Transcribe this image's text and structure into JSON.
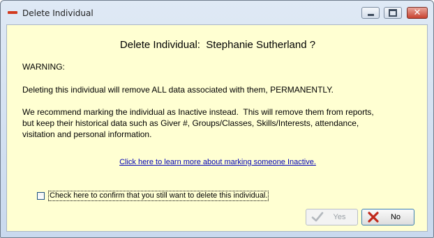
{
  "window": {
    "title": "Delete Individual",
    "controls": {
      "minimize": "minimize",
      "maximize": "maximize",
      "close": "close"
    }
  },
  "dialog": {
    "heading": "Delete Individual:  Stephanie Sutherland ?",
    "warning": "WARNING:",
    "delete_message": "Deleting this individual will remove ALL data associated with them, PERMANENTLY.",
    "recommendation": "We recommend marking the individual as Inactive instead.  This will remove them from reports,\nbut keep their historical data such as Giver #, Groups/Classes, Skills/Interests, attendance,\nvisitation and personal information.",
    "learn_more_link": "Click here to learn more about marking someone Inactive.",
    "confirm_checkbox": {
      "label": "Check here to confirm that you still want to delete this individual.",
      "checked": false
    }
  },
  "buttons": {
    "yes": {
      "label": "Yes",
      "enabled": false,
      "icon": "checkmark-icon"
    },
    "no": {
      "label": "No",
      "enabled": true,
      "icon": "red-x-icon"
    }
  },
  "colors": {
    "client_background": "#ffffd2",
    "link": "#0000b4",
    "accent_red": "#d23a1e"
  }
}
